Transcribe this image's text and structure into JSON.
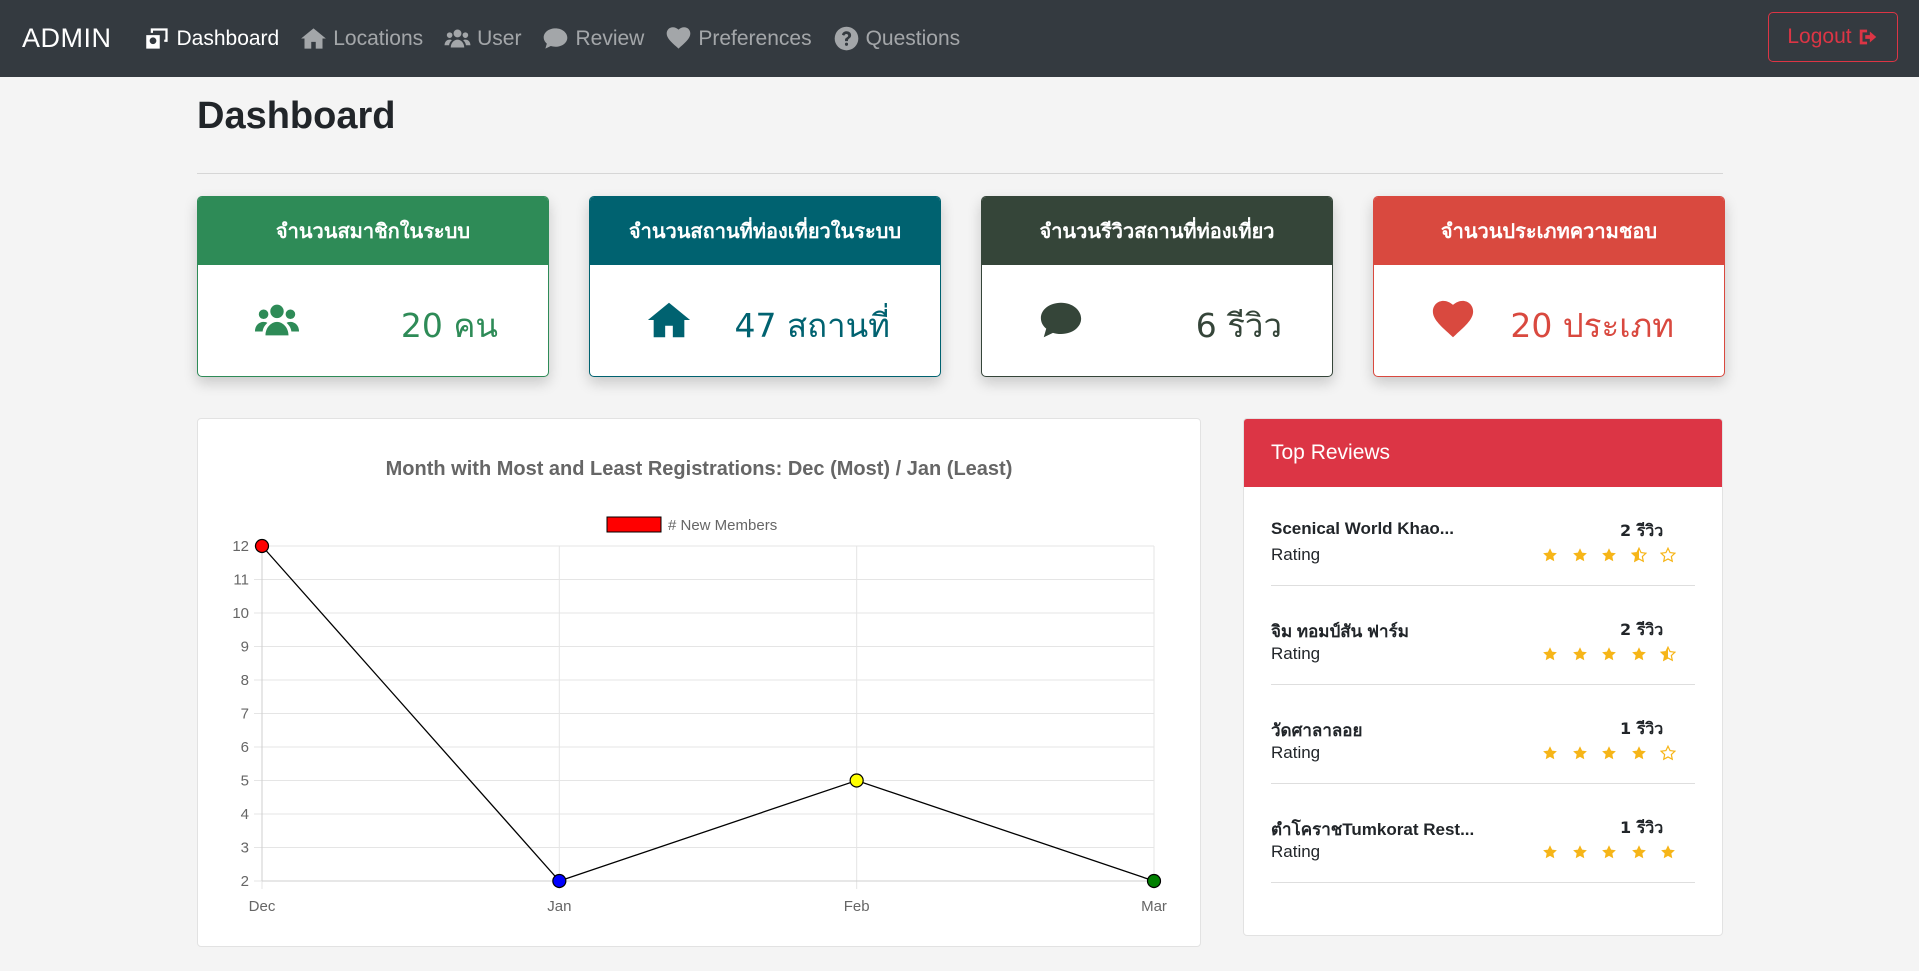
{
  "nav": {
    "brand": "ADMIN",
    "items": [
      {
        "key": "dashboard",
        "label": "Dashboard",
        "icon": "dashboard-icon",
        "active": true
      },
      {
        "key": "locations",
        "label": "Locations",
        "icon": "home-icon",
        "active": false
      },
      {
        "key": "user",
        "label": "User",
        "icon": "users-icon",
        "active": false
      },
      {
        "key": "review",
        "label": "Review",
        "icon": "comment-icon",
        "active": false
      },
      {
        "key": "preferences",
        "label": "Preferences",
        "icon": "heart-icon",
        "active": false
      },
      {
        "key": "questions",
        "label": "Questions",
        "icon": "question-circle-icon",
        "active": false
      }
    ],
    "logout_label": "Logout"
  },
  "page": {
    "title": "Dashboard"
  },
  "stats": [
    {
      "label": "จำนวนสมาชิกในระบบ",
      "value": "20 คน",
      "icon": "users-icon",
      "color": "#2e8b57"
    },
    {
      "label": "จำนวนสถานที่ท่องเที่ยวในระบบ",
      "value": "47 สถานที่",
      "icon": "home-icon",
      "color": "#006270"
    },
    {
      "label": "จำนวนรีวิวสถานที่ท่องเที่ยว",
      "value": "6 รีวิว",
      "icon": "comment-icon",
      "color": "#354539"
    },
    {
      "label": "จำนวนประเภทความชอบ",
      "value": "20 ประเภท",
      "icon": "heart-icon",
      "color": "#d9493f"
    }
  ],
  "chart_data": {
    "type": "line",
    "title": "Month with Most and Least Registrations: Dec (Most) / Jan (Least)",
    "categories": [
      "Dec",
      "Jan",
      "Feb",
      "Mar"
    ],
    "series": [
      {
        "name": "# New Members",
        "values": [
          12,
          2,
          5,
          2
        ],
        "point_colors": [
          "#ff0000",
          "#0000ff",
          "#ffff00",
          "#008000"
        ],
        "line_color": "#000000",
        "legend_color": "#ff0000"
      }
    ],
    "ylim": [
      2,
      12
    ],
    "yticks": [
      2,
      3,
      4,
      5,
      6,
      7,
      8,
      9,
      10,
      11,
      12
    ],
    "grid": true,
    "legend": "top-center"
  },
  "reviews": {
    "title": "Top Reviews",
    "rating_label": "Rating",
    "items": [
      {
        "name": "Scenical World Khao...",
        "count": "2 รีวิว",
        "rating": 3.5
      },
      {
        "name": "จิม ทอมป์สัน ฟาร์ม",
        "count": "2 รีวิว",
        "rating": 4.5
      },
      {
        "name": "วัดศาลาลอย",
        "count": "1 รีวิว",
        "rating": 4
      },
      {
        "name": "ตำโคราชTumkorat Rest...",
        "count": "1 รีวิว",
        "rating": 5
      }
    ]
  }
}
